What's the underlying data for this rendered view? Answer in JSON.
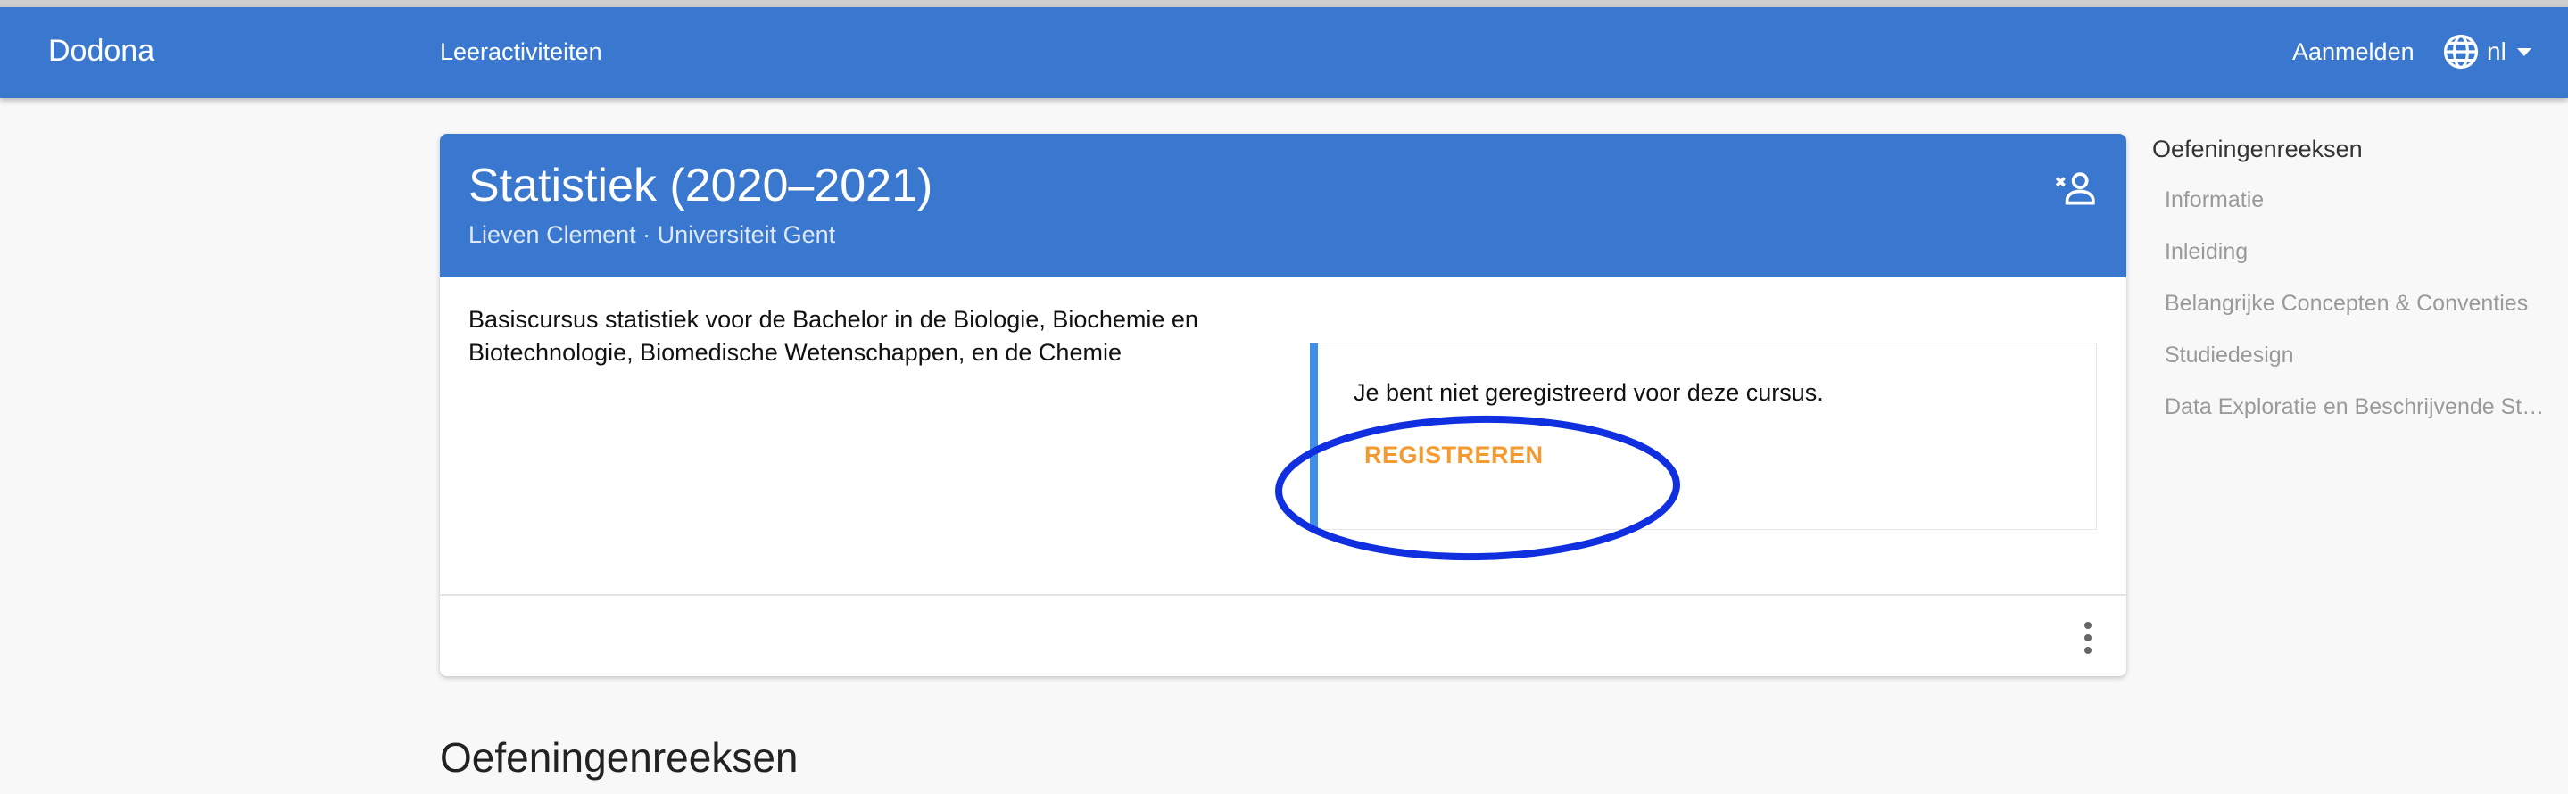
{
  "navbar": {
    "brand": "Dodona",
    "nav_link": "Leeractiviteiten",
    "signin": "Aanmelden",
    "language": "nl"
  },
  "course": {
    "title": "Statistiek (2020–2021)",
    "subtitle": "Lieven Clement · Universiteit Gent",
    "description": "Basiscursus statistiek voor de Bachelor in de Biologie, Biochemie en Biotechnologie, Biomedische Wetenschappen, en de Chemie",
    "registration": {
      "message": "Je bent niet geregistreerd voor deze cursus.",
      "button_label": "REGISTREREN"
    }
  },
  "section_title": "Oefeningenreeksen",
  "toc": {
    "title": "Oefeningenreeksen",
    "items": [
      "Informatie",
      "Inleiding",
      "Belangrijke Concepten & Conventies",
      "Studiedesign",
      "Data Exploratie en Beschrijvende Statistiek"
    ]
  },
  "colors": {
    "primary": "#3a78cf",
    "accent_orange": "#f39a30",
    "highlight_blue": "#1030e0",
    "info_border": "#3f8ee8"
  }
}
